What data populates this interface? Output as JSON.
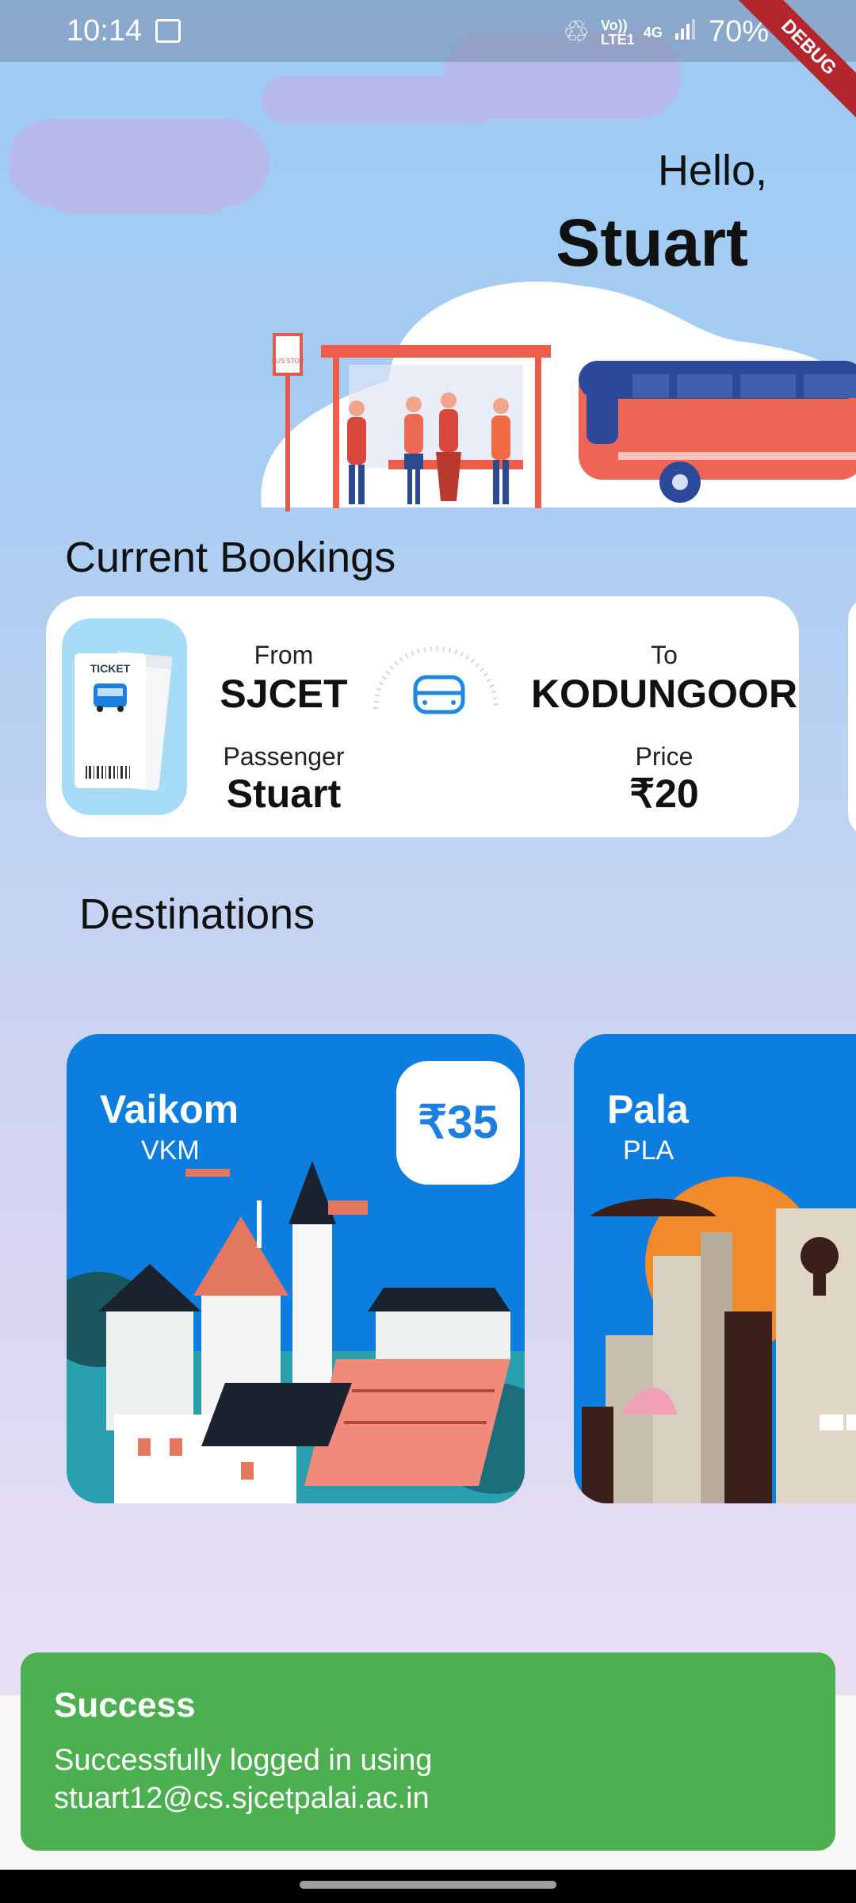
{
  "status_bar": {
    "time": "10:14",
    "signal_volte": "Vo)) LTE1",
    "network": "4G",
    "battery": "70%",
    "debug_label": "DEBUG"
  },
  "greeting": {
    "hello": "Hello,",
    "name": "Stuart"
  },
  "illustration": {
    "sign_text": "BUS STOP"
  },
  "current_bookings": {
    "title": "Current Bookings",
    "ticket_label": "TICKET",
    "from_label": "From",
    "from_value": "SJCET",
    "to_label": "To",
    "to_value": "KODUNGOOR",
    "passenger_label": "Passenger",
    "passenger_value": "Stuart",
    "price_label": "Price",
    "price_value": "₹20"
  },
  "destinations": {
    "title": "Destinations",
    "items": [
      {
        "name": "Vaikom",
        "code": "VKM",
        "price": "₹35"
      },
      {
        "name": "Pala",
        "code": "PLA"
      }
    ]
  },
  "snackbar": {
    "title": "Success",
    "message": "Successfully logged in using stuart12@cs.sjcetpalai.ac.in",
    "color": "#4caf50"
  },
  "colors": {
    "accent": "#0d7de0",
    "price_text": "#1e7fe0"
  }
}
